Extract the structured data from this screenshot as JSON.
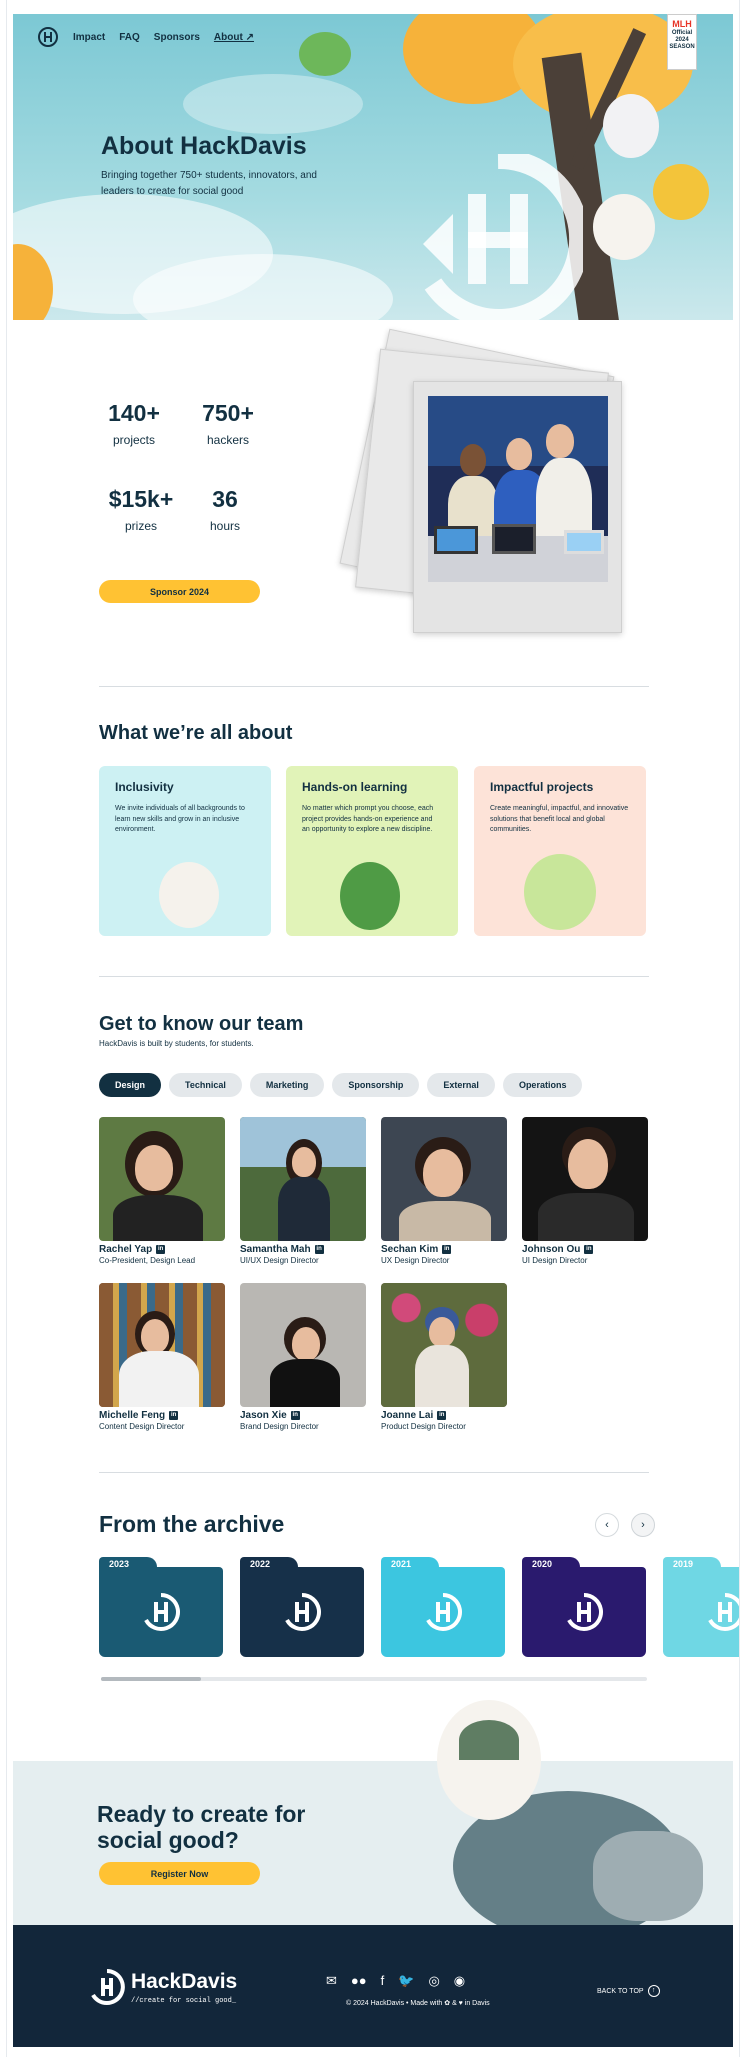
{
  "nav": {
    "items": [
      {
        "label": "Impact"
      },
      {
        "label": "FAQ"
      },
      {
        "label": "Sponsors"
      },
      {
        "label": "About ↗"
      }
    ]
  },
  "badge": {
    "title": "MLH",
    "line1": "Official",
    "line2": "2024",
    "line3": "SEASON"
  },
  "hero": {
    "title": "About HackDavis",
    "subtitle": "Bringing together 750+ students, innovators, and leaders to create for social good"
  },
  "stats": [
    {
      "value": "140+",
      "label": "projects"
    },
    {
      "value": "750+",
      "label": "hackers"
    },
    {
      "value": "$15k+",
      "label": "prizes"
    },
    {
      "value": "36",
      "label": "hours"
    }
  ],
  "sponsor_button": "Sponsor 2024",
  "about": {
    "title": "What we’re all about",
    "cards": [
      {
        "title": "Inclusivity",
        "text": "We invite individuals of all backgrounds to learn new skills and grow in an inclusive environment.",
        "color": "#cdf1f3"
      },
      {
        "title": "Hands-on learning",
        "text": "No matter which prompt you choose, each project provides hands-on experience and an opportunity to explore a new discipline.",
        "color": "#e1f3b8"
      },
      {
        "title": "Impactful projects",
        "text": "Create meaningful, impactful, and innovative solutions that benefit local and global communities.",
        "color": "#fde3d8"
      }
    ]
  },
  "team": {
    "title": "Get to know our team",
    "subtitle": "HackDavis is built by students, for students.",
    "tabs": [
      "Design",
      "Technical",
      "Marketing",
      "Sponsorship",
      "External",
      "Operations"
    ],
    "members": [
      {
        "name": "Rachel Yap",
        "role": "Co-President, Design Lead"
      },
      {
        "name": "Samantha Mah",
        "role": "UI/UX Design Director"
      },
      {
        "name": "Sechan Kim",
        "role": "UX Design Director"
      },
      {
        "name": "Johnson Ou",
        "role": "UI Design Director"
      },
      {
        "name": "Michelle Feng",
        "role": "Content Design Director"
      },
      {
        "name": "Jason Xie",
        "role": "Brand Design Director"
      },
      {
        "name": "Joanne Lai",
        "role": "Product Design Director"
      }
    ],
    "linkedin_glyph": "in"
  },
  "archive": {
    "title": "From the archive",
    "prev": "‹",
    "next": "›",
    "years": [
      "2023",
      "2022",
      "2021",
      "2020",
      "2019"
    ],
    "colors": [
      "#1a5a73",
      "#163049",
      "#3cc6e0",
      "#2a1a6e",
      "#6fd7e4"
    ]
  },
  "cta": {
    "title": "Ready to create for social good?",
    "button": "Register Now"
  },
  "footer": {
    "brand": "HackDavis",
    "tagline": "//create for social good_",
    "copyright": "© 2024 HackDavis • Made with ✿ & ♥ in Davis",
    "back_to_top": "BACK TO TOP",
    "back_glyph": "↑",
    "social_icons": [
      "mail-icon",
      "medium-icon",
      "facebook-icon",
      "twitter-icon",
      "instagram-icon",
      "discord-icon"
    ],
    "social_glyphs": [
      "✉",
      "●●",
      "f",
      "🐦",
      "◎",
      "◉"
    ]
  }
}
